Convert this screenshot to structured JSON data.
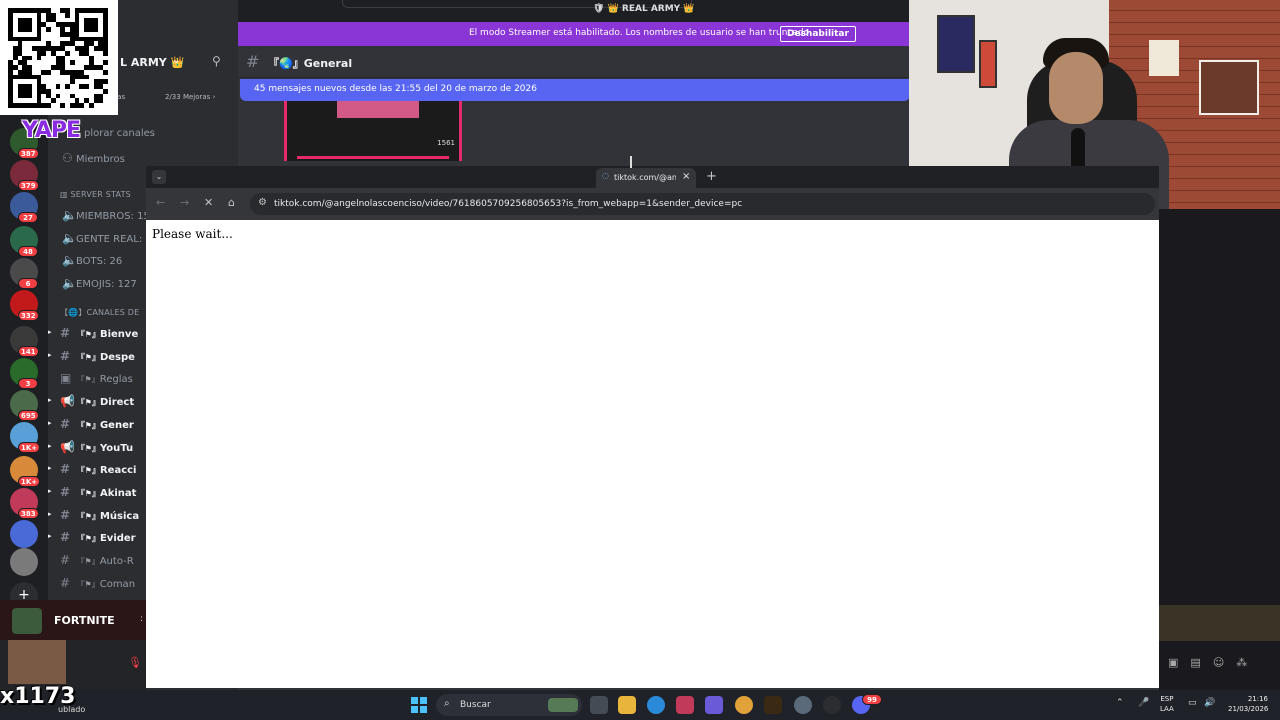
{
  "discord": {
    "server_name": "REAL ARMY",
    "guild_header_name": "L ARMY",
    "streamer_notice": "El modo Streamer está habilitado. Los nombres de usuario se han truncado.",
    "streamer_button": "Deshabilitar",
    "channel_title": "General",
    "new_messages_banner": "45 mensajes nuevos desde las 21:55 del 20 de marzo de 2026",
    "boost_left": "oras",
    "boost_right": "2/33 Mejoras",
    "explore_channels": "plorar canales",
    "members_link": "Miembros",
    "image_count": "1561",
    "categories": [
      {
        "label": "SERVER STATS"
      },
      {
        "label": "CANALES DE"
      }
    ],
    "stats": [
      "MIEMBROS: 15",
      "GENTE REAL:",
      "BOTS: 26",
      "EMOJIS: 127"
    ],
    "channels": [
      {
        "label": "Bienve"
      },
      {
        "label": "Despe"
      },
      {
        "label": "Reglas"
      },
      {
        "label": "Direct"
      },
      {
        "label": "Gener"
      },
      {
        "label": "YouTu"
      },
      {
        "label": "Reacci"
      },
      {
        "label": "Akinat"
      },
      {
        "label": "Música"
      },
      {
        "label": "Evider"
      },
      {
        "label": "Auto-R"
      },
      {
        "label": "Coman"
      }
    ],
    "server_badges": [
      "387",
      "379",
      "27",
      "48",
      "6",
      "332",
      "141",
      "3",
      "695",
      "1K+",
      "1K+",
      "383"
    ]
  },
  "overlay": {
    "yape_text": "YAPE",
    "fortnite_text": "FORTNITE",
    "multiplier": "x1173",
    "weather": "ublado"
  },
  "browser": {
    "tab_title": "tiktok.com/@ang",
    "url": "tiktok.com/@angelnolascoenciso/video/7618605709256805653?is_from_webapp=1&sender_device=pc",
    "page_text": "Please wait..."
  },
  "taskbar": {
    "search_label": "Buscar",
    "lang_top": "ESP",
    "lang_bottom": "LAA",
    "time": "21:16",
    "date": "21/03/2026",
    "discord_badge": "99"
  },
  "colors": {
    "streamer_bar": "#8a35d6",
    "blurple": "#5865f2",
    "badge_red": "#f23f43"
  }
}
